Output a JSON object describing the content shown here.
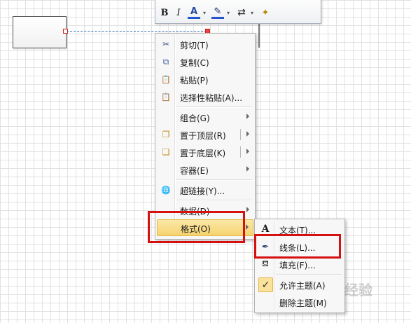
{
  "mini_toolbar": {
    "bold_label": "B",
    "italic_label": "I",
    "font_color_label": "A",
    "dropdown_glyph": "▾",
    "pen_glyph": "✎",
    "arrows_glyph": "⇄",
    "brush_glyph": "✦"
  },
  "context_menu": {
    "items": [
      {
        "label": "剪切(T)",
        "icon": "scissors-icon",
        "glyph": "✂"
      },
      {
        "label": "复制(C)",
        "icon": "copy-icon",
        "glyph": "⧉"
      },
      {
        "label": "粘贴(P)",
        "icon": "paste-icon",
        "glyph": "📋"
      },
      {
        "label": "选择性粘贴(A)...",
        "icon": "paste-special-icon",
        "glyph": "📋"
      },
      {
        "label": "组合(G)",
        "icon": "",
        "glyph": ""
      },
      {
        "label": "置于顶层(R)",
        "icon": "bring-to-front-icon",
        "glyph": "❐"
      },
      {
        "label": "置于底层(K)",
        "icon": "send-to-back-icon",
        "glyph": "❏"
      },
      {
        "label": "容器(E)",
        "icon": "",
        "glyph": ""
      },
      {
        "label": "超链接(Y)...",
        "icon": "hyperlink-globe-icon",
        "glyph": "🌐"
      },
      {
        "label": "数据(D)",
        "icon": "",
        "glyph": ""
      },
      {
        "label": "格式(O)",
        "icon": "",
        "glyph": ""
      }
    ]
  },
  "format_submenu": {
    "items": [
      {
        "label": "文本(T)...",
        "icon": "text-icon",
        "glyph": "A"
      },
      {
        "label": "线条(L)...",
        "icon": "line-pen-icon",
        "glyph": "✒"
      },
      {
        "label": "填充(F)...",
        "icon": "fill-bucket-icon",
        "glyph": "⛾"
      },
      {
        "label": "允许主题(A)",
        "icon": "check-icon",
        "glyph": "✓"
      },
      {
        "label": "删除主题(M)",
        "icon": "",
        "glyph": ""
      }
    ]
  },
  "watermark": "经验",
  "colors": {
    "highlight": "#f5d36e",
    "annotation": "#d41010",
    "connector": "#3a6fb0"
  }
}
